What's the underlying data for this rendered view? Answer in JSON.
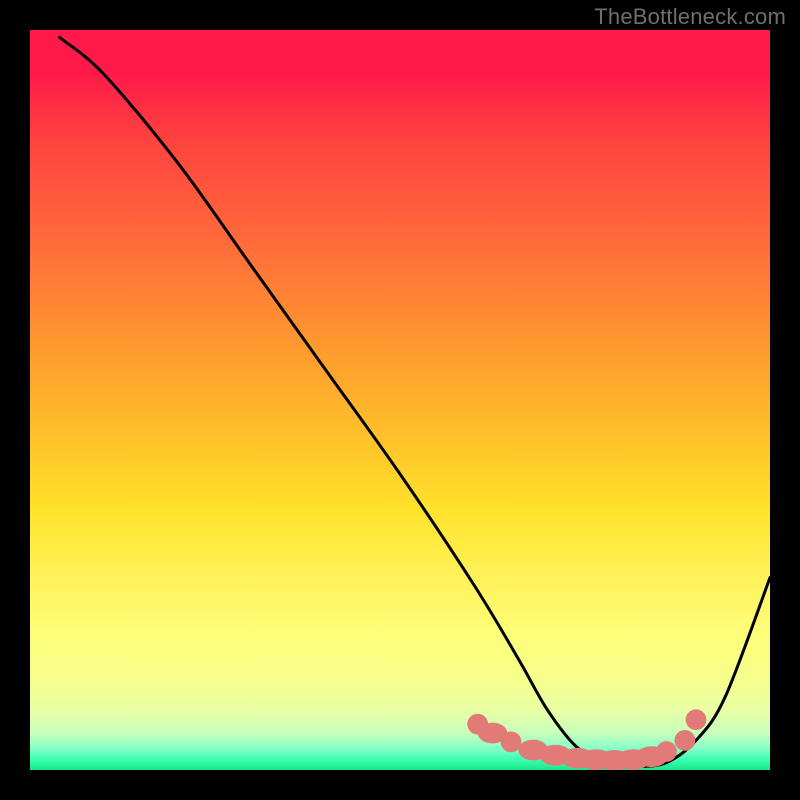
{
  "watermark": "TheBottleneck.com",
  "chart_data": {
    "type": "line",
    "title": "",
    "xlabel": "",
    "ylabel": "",
    "xlim": [
      0,
      100
    ],
    "ylim": [
      0,
      100
    ],
    "series": [
      {
        "name": "curve",
        "x": [
          4,
          10,
          20,
          30,
          40,
          50,
          60,
          66,
          70,
          74,
          78,
          82,
          86,
          90,
          94,
          100
        ],
        "y": [
          99,
          94,
          82,
          68,
          54,
          40,
          25,
          15,
          8,
          3,
          1,
          0.5,
          1,
          4,
          10,
          26
        ]
      }
    ],
    "markers": {
      "name": "selected-points",
      "color": "#e27a78",
      "x": [
        60.5,
        62.5,
        65.0,
        68.0,
        71.0,
        74.0,
        76.5,
        79.0,
        81.5,
        84.0,
        86.0,
        88.5,
        90.0
      ],
      "y": [
        6.2,
        5.0,
        3.8,
        2.7,
        2.0,
        1.6,
        1.4,
        1.3,
        1.4,
        1.8,
        2.5,
        4.0,
        6.8
      ],
      "rx": [
        1.4,
        2.0,
        1.4,
        2.0,
        2.2,
        2.2,
        2.2,
        2.2,
        2.2,
        2.2,
        1.4,
        1.4,
        1.4
      ],
      "ry": [
        1.4,
        1.4,
        1.4,
        1.4,
        1.4,
        1.4,
        1.4,
        1.4,
        1.4,
        1.4,
        1.4,
        1.4,
        1.4
      ]
    },
    "background_gradient": {
      "top": "#ff1a4a",
      "mid_upper": "#ff9a2e",
      "mid": "#ffe32a",
      "mid_lower": "#f6ff8e",
      "bottom": "#18e887"
    }
  }
}
